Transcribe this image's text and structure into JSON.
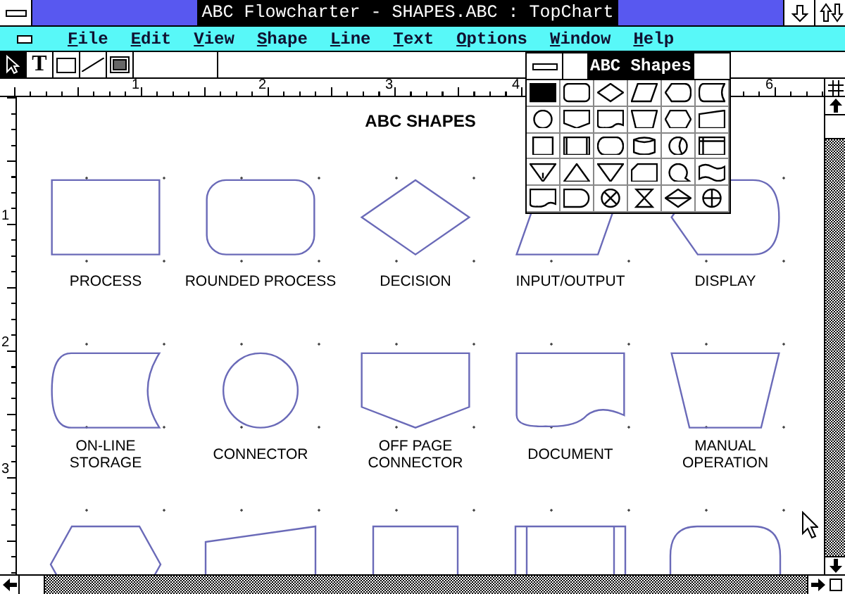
{
  "window": {
    "title": "ABC Flowcharter - SHAPES.ABC : TopChart"
  },
  "menu": [
    "File",
    "Edit",
    "View",
    "Shape",
    "Line",
    "Text",
    "Options",
    "Window",
    "Help"
  ],
  "tools": [
    {
      "kind": "pointer",
      "selected": true
    },
    {
      "kind": "text",
      "label": "T",
      "selected": false
    },
    {
      "kind": "rectangle",
      "selected": false
    },
    {
      "kind": "line",
      "selected": false
    },
    {
      "kind": "shade",
      "selected": false
    }
  ],
  "ruler": {
    "horizontal": [
      {
        "label": "1"
      },
      {
        "label": "2"
      },
      {
        "label": "3"
      },
      {
        "label": "4"
      },
      {
        "label": "6",
        "gap": true
      }
    ],
    "vertical": [
      {
        "label": "1"
      },
      {
        "label": "2"
      },
      {
        "label": "3"
      }
    ]
  },
  "canvas": {
    "heading": "ABC SHAPES",
    "shapes": [
      {
        "kind": "process",
        "label": "PROCESS"
      },
      {
        "kind": "rounded",
        "label": "ROUNDED PROCESS"
      },
      {
        "kind": "decision",
        "label": "DECISION"
      },
      {
        "kind": "io",
        "label": "INPUT/OUTPUT"
      },
      {
        "kind": "display",
        "label": "DISPLAY"
      },
      {
        "kind": "storage",
        "label": "ON-LINE\nSTORAGE"
      },
      {
        "kind": "connector",
        "label": "CONNECTOR"
      },
      {
        "kind": "offpage",
        "label": "OFF PAGE\nCONNECTOR"
      },
      {
        "kind": "document",
        "label": "DOCUMENT"
      },
      {
        "kind": "manual",
        "label": "MANUAL\nOPERATION"
      },
      {
        "kind": "preparation"
      },
      {
        "kind": "manualinput"
      },
      {
        "kind": "square"
      },
      {
        "kind": "predefined"
      },
      {
        "kind": "roundtop"
      }
    ]
  },
  "palette": {
    "title": "ABC Shapes",
    "cells": [
      {
        "kind": "process",
        "selected": true
      },
      {
        "kind": "rounded",
        "selected": false
      },
      {
        "kind": "decision",
        "selected": false
      },
      {
        "kind": "io",
        "selected": false
      },
      {
        "kind": "display",
        "selected": false
      },
      {
        "kind": "storage",
        "selected": false
      },
      {
        "kind": "connector",
        "selected": false
      },
      {
        "kind": "offpage",
        "selected": false
      },
      {
        "kind": "document",
        "selected": false
      },
      {
        "kind": "manual",
        "selected": false
      },
      {
        "kind": "preparation",
        "selected": false
      },
      {
        "kind": "manualinput",
        "selected": false
      },
      {
        "kind": "square",
        "selected": false
      },
      {
        "kind": "predefined",
        "selected": false
      },
      {
        "kind": "oval",
        "selected": false
      },
      {
        "kind": "disk",
        "selected": false
      },
      {
        "kind": "direct",
        "selected": false
      },
      {
        "kind": "internal",
        "selected": false
      },
      {
        "kind": "extract",
        "selected": false
      },
      {
        "kind": "triangleup",
        "selected": false
      },
      {
        "kind": "triangledown",
        "selected": false
      },
      {
        "kind": "card",
        "selected": false
      },
      {
        "kind": "tape",
        "selected": false
      },
      {
        "kind": "punched",
        "selected": false
      },
      {
        "kind": "document",
        "selected": false
      },
      {
        "kind": "delay",
        "selected": false
      },
      {
        "kind": "summing",
        "selected": false
      },
      {
        "kind": "collate",
        "selected": false
      },
      {
        "kind": "sort",
        "selected": false
      },
      {
        "kind": "or",
        "selected": false
      }
    ]
  }
}
